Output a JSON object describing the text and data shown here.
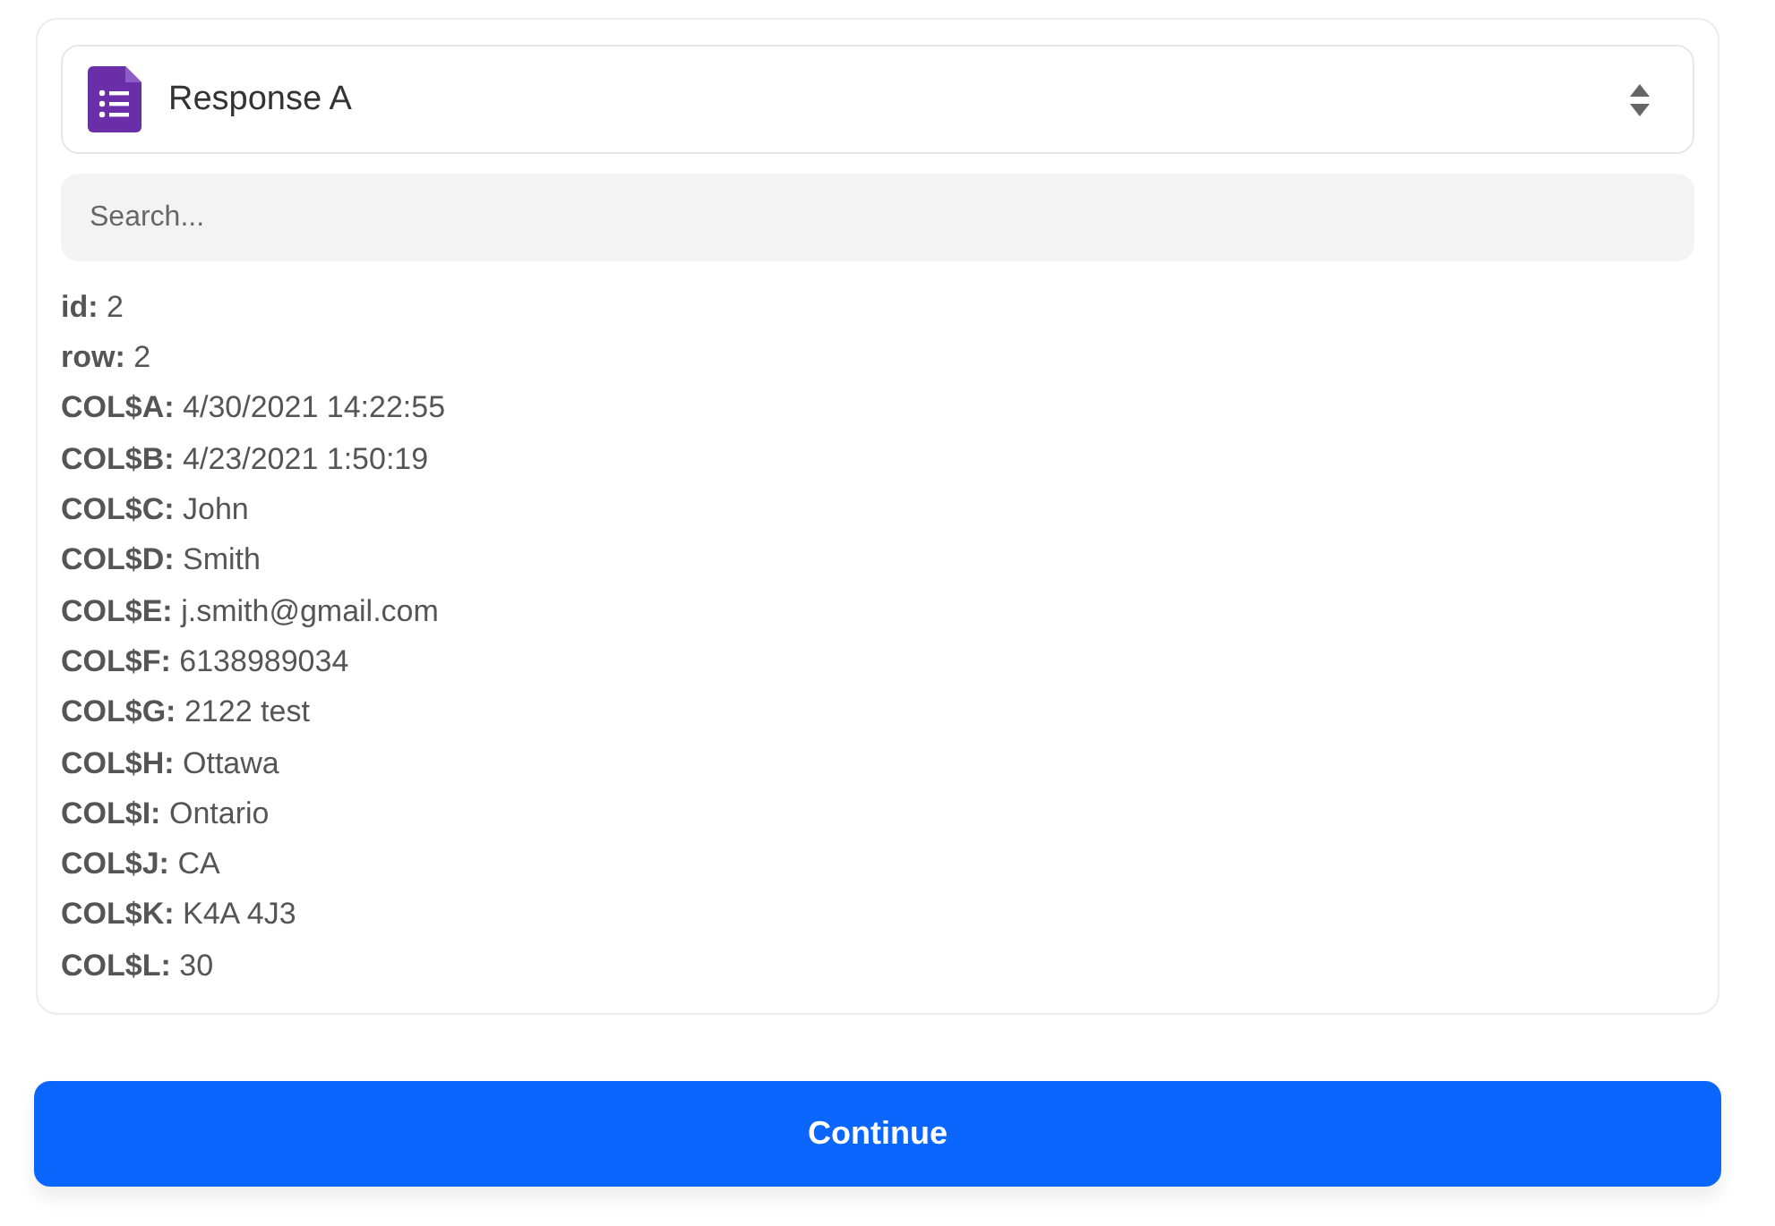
{
  "dropdown": {
    "label": "Response A"
  },
  "search": {
    "placeholder": "Search..."
  },
  "fields": [
    {
      "key": "id:",
      "value": "2"
    },
    {
      "key": "row:",
      "value": "2"
    },
    {
      "key": "COL$A:",
      "value": "4/30/2021 14:22:55"
    },
    {
      "key": "COL$B:",
      "value": "4/23/2021 1:50:19"
    },
    {
      "key": "COL$C:",
      "value": "John"
    },
    {
      "key": "COL$D:",
      "value": "Smith"
    },
    {
      "key": "COL$E:",
      "value": "j.smith@gmail.com"
    },
    {
      "key": "COL$F:",
      "value": "6138989034"
    },
    {
      "key": "COL$G:",
      "value": "2122 test"
    },
    {
      "key": "COL$H:",
      "value": "Ottawa"
    },
    {
      "key": "COL$I:",
      "value": "Ontario"
    },
    {
      "key": "COL$J:",
      "value": "CA"
    },
    {
      "key": "COL$K:",
      "value": "K4A 4J3"
    },
    {
      "key": "COL$L:",
      "value": "30"
    }
  ],
  "button": {
    "label": "Continue"
  }
}
